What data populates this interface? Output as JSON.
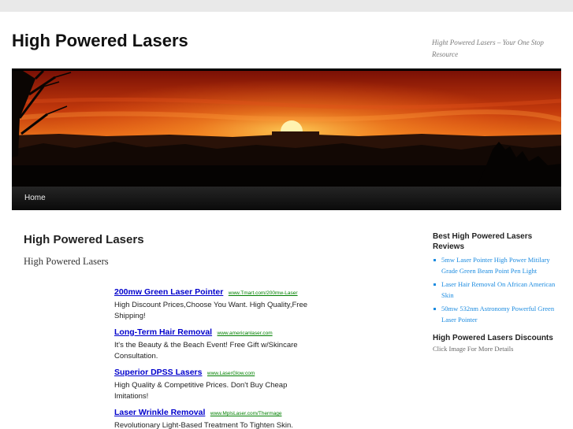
{
  "header": {
    "site_title": "High Powered Lasers",
    "site_description": "Hight Powered Lasers – Your One Stop Resource"
  },
  "nav": {
    "home_label": "Home"
  },
  "colors": {
    "link_blue": "#1b8be0",
    "ad_title_blue": "#0000cc",
    "ad_url_green": "#008000",
    "nav_bg": "#111111"
  },
  "main": {
    "entry_title": "High Powered Lasers",
    "entry_subtitle": "High Powered Lasers",
    "ads": [
      {
        "title": "200mw Green Laser Pointer",
        "url": "www.Tmart.com/200mw-Laser",
        "description": "High Discount Prices,Choose You Want. High Quality,Free Shipping!"
      },
      {
        "title": "Long-Term Hair Removal",
        "url": "www.americanlaser.com",
        "description": "It's the Beauty & the Beach Event! Free Gift w/Skincare Consultation."
      },
      {
        "title": "Superior DPSS Lasers",
        "url": "www.LaserGlow.com",
        "description": "High Quality & Competitive Prices. Don't Buy Cheap Imitations!"
      },
      {
        "title": "Laser Wrinkle Removal",
        "url": "www.MplsLaser.com/Thermage",
        "description": "Revolutionary Light-Based Treatment To Tighten Skin. Free Consultation!"
      }
    ]
  },
  "sidebar": {
    "widget1_title": "Best High Powered Lasers Reviews",
    "widget1_items": [
      "5mw Laser Pointer High Power Mitilary Grade Green Beam Point Pen Light",
      "Laser Hair Removal On African American Skin",
      "50mw 532nm Astronomy Powerful Green Laser Pointer"
    ],
    "widget2_title": "High Powered Lasers Discounts",
    "widget2_text": "Click Image For More Details"
  }
}
